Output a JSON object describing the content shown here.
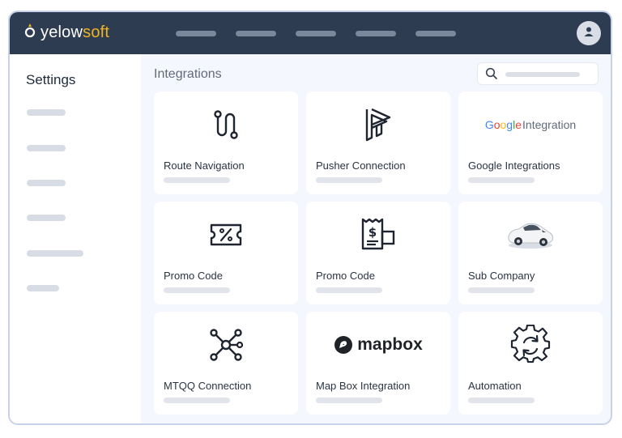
{
  "app": {
    "logo_text_part1": "yelow",
    "logo_text_part2": "soft",
    "logo_icon": "brand-drop-icon",
    "brand_color": "#f0b323",
    "topbar_color": "#2e3c52"
  },
  "header": {
    "nav_placeholder_count": 5,
    "avatar_icon": "user-icon"
  },
  "sidebar": {
    "title": "Settings",
    "placeholder_count": 6
  },
  "main": {
    "title": "Integrations",
    "search_icon": "search-icon"
  },
  "cards": [
    {
      "label": "Route Navigation",
      "icon": "route-icon"
    },
    {
      "label": "Pusher Connection",
      "icon": "pusher-logo-icon"
    },
    {
      "label": "Google Integrations",
      "icon": "google-logo-icon",
      "logo_word": "Google",
      "logo_suffix": "Integration"
    },
    {
      "label": "Promo Code",
      "icon": "ticket-percent-icon"
    },
    {
      "label": "Promo Code",
      "icon": "receipt-dollar-icon"
    },
    {
      "label": "Sub Company",
      "icon": "car-icon"
    },
    {
      "label": "MTQQ Connection",
      "icon": "network-hub-icon"
    },
    {
      "label": "Map Box Integration",
      "icon": "mapbox-logo-icon",
      "logo_word": "mapbox"
    },
    {
      "label": "Automation",
      "icon": "gear-cycle-icon"
    }
  ]
}
